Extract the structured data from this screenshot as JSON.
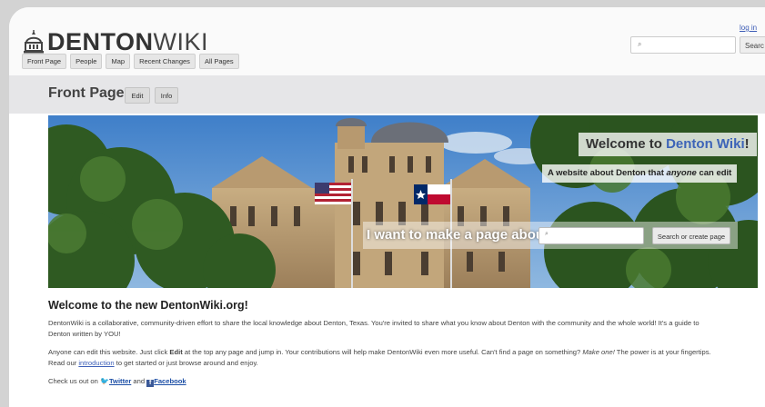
{
  "header": {
    "logo_bold": "DENTON",
    "logo_light": "WIKI",
    "nav_tabs": [
      "Front Page",
      "People",
      "Map",
      "Recent Changes",
      "All Pages"
    ],
    "login_label": "log in",
    "search_button_label": "Searc"
  },
  "page": {
    "title": "Front Page",
    "edit_label": "Edit",
    "info_label": "Info"
  },
  "banner": {
    "welcome_prefix": "Welcome to ",
    "welcome_accent": "Denton Wiki",
    "welcome_suffix": "!",
    "tagline_prefix": "A website about Denton that ",
    "tagline_em": "anyone",
    "tagline_suffix": " can edit",
    "make_page_label": "I want to make a page about",
    "make_page_button": "Search or create page"
  },
  "content": {
    "heading": "Welcome to the new DentonWiki.org!",
    "p1_line1": "DentonWiki is a collaborative, community-driven effort to share the local knowledge about Denton, Texas. You're invited to share what you know about Denton with the community and the whole world! It's a guide to",
    "p1_line2": "Denton written by YOU!",
    "p2_a": "Anyone can edit this website. Just click ",
    "p2_bold": "Edit",
    "p2_b": " at the top any page and jump in. Your contributions will help make DentonWiki even more useful. Can't find a page on something? ",
    "p2_italic": "Make one!",
    "p2_c": " The power is at your fingertips.",
    "p3_a": "Read our ",
    "p3_link": "introduction",
    "p3_b": " to get started or just browse around and enjoy.",
    "p4_a": "Check us out on ",
    "twitter": "Twitter",
    "p4_and": " and ",
    "facebook": "Facebook"
  },
  "colors": {
    "accent": "#3d64b8",
    "link": "#3d5fb8",
    "titlebar": "#e6e6e8"
  }
}
